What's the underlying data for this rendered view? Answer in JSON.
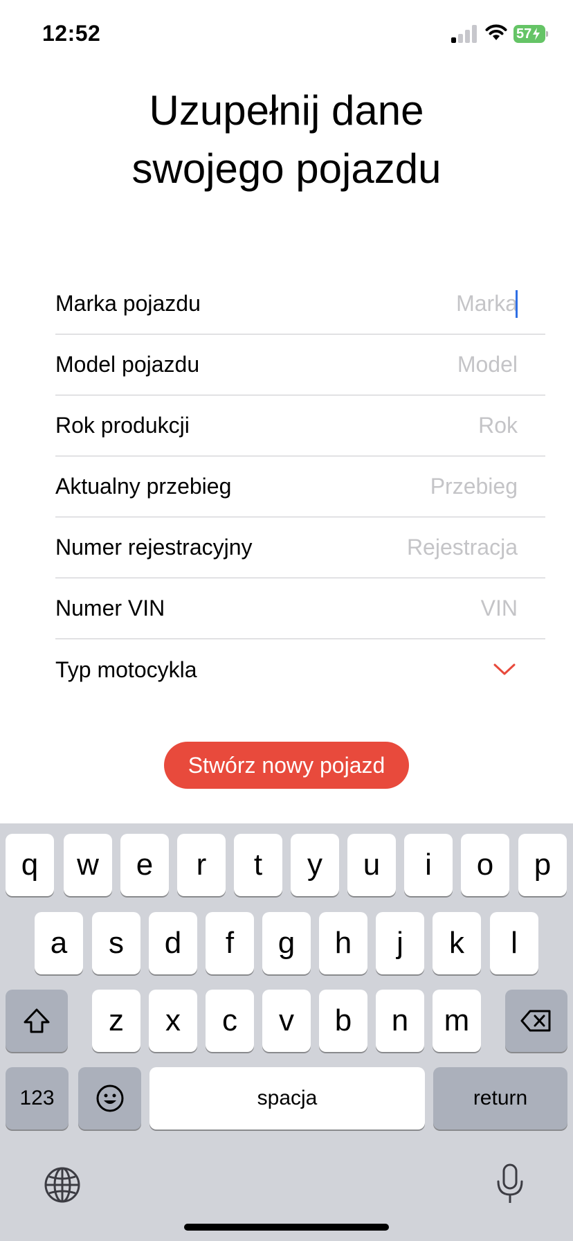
{
  "status_bar": {
    "time": "12:52",
    "battery_level": "57",
    "signal_bars_active": 1,
    "signal_bars_total": 4,
    "icons": [
      "cellular-signal-icon",
      "wifi-icon",
      "battery-charging-icon"
    ]
  },
  "title": "Uzupełnij dane\nswojego pojazdu",
  "form": {
    "rows": [
      {
        "label": "Marka pojazdu",
        "placeholder": "Marka",
        "value": "",
        "focused": true
      },
      {
        "label": "Model pojazdu",
        "placeholder": "Model",
        "value": ""
      },
      {
        "label": "Rok produkcji",
        "placeholder": "Rok",
        "value": ""
      },
      {
        "label": "Aktualny przebieg",
        "placeholder": "Przebieg",
        "value": ""
      },
      {
        "label": "Numer rejestracyjny",
        "placeholder": "Rejestracja",
        "value": ""
      },
      {
        "label": "Numer VIN",
        "placeholder": "VIN",
        "value": ""
      },
      {
        "label": "Typ motocykla",
        "icon": "chevron-down-icon"
      }
    ]
  },
  "create_button": {
    "label": "Stwórz nowy pojazd"
  },
  "colors": {
    "accent": "#e84a3c",
    "cursor": "#2f6fe4",
    "placeholder": "#c4c4c7",
    "keyboard_bg": "#d1d3d9",
    "battery": "#65c466"
  },
  "keyboard": {
    "row1": [
      "q",
      "w",
      "e",
      "r",
      "t",
      "y",
      "u",
      "i",
      "o",
      "p"
    ],
    "row2": [
      "a",
      "s",
      "d",
      "f",
      "g",
      "h",
      "j",
      "k",
      "l"
    ],
    "row3": [
      "z",
      "x",
      "c",
      "v",
      "b",
      "n",
      "m"
    ],
    "numbers_label": "123",
    "space_label": "spacja",
    "return_label": "return",
    "icons": [
      "shift-icon",
      "backspace-icon",
      "emoji-icon",
      "globe-icon",
      "microphone-icon"
    ]
  }
}
